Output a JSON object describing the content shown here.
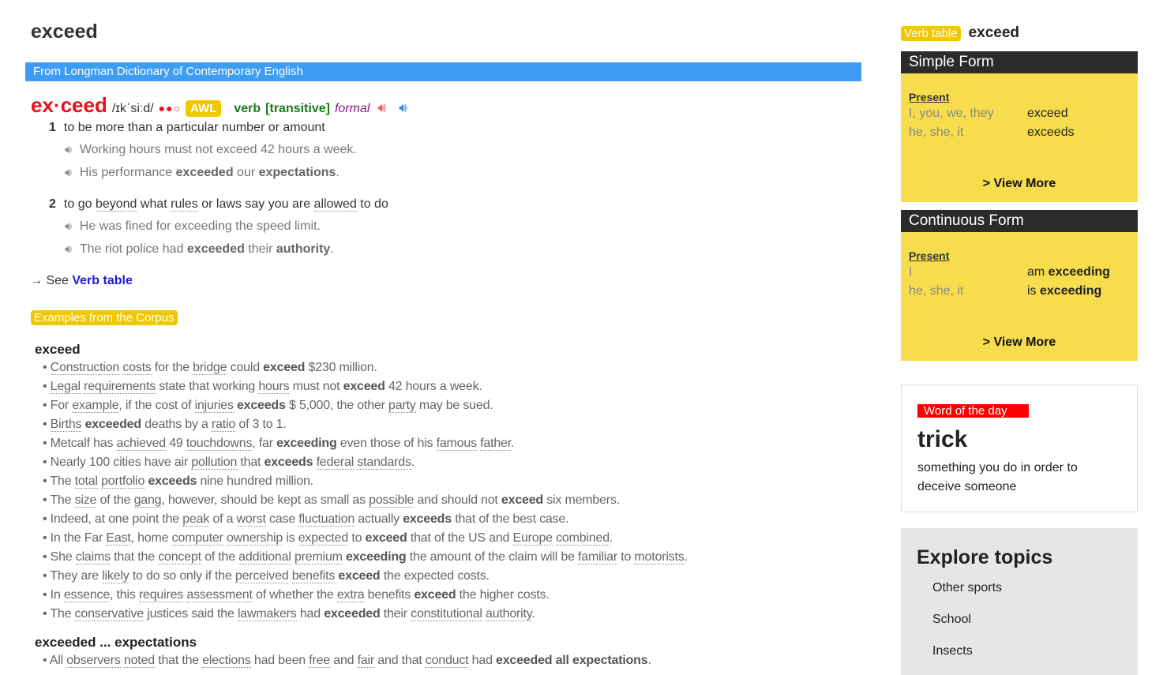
{
  "headword": "exceed",
  "source": "From Longman Dictionary of Contemporary English",
  "entry": {
    "hwd": "ex·ceed",
    "pron": "/ɪkˈsiːd/",
    "frequency_dots": "●●○",
    "awl": "AWL",
    "pos": "verb",
    "gram": "[transitive]",
    "register": "formal",
    "icons": {
      "british_audio": "speaker-red-icon",
      "american_audio": "speaker-blue-icon"
    },
    "colors": {
      "headword": "#e8101c",
      "pos": "#1d7a1d",
      "register": "#8a1a8a",
      "awl": "#f0c800"
    }
  },
  "senses": [
    {
      "num": "1",
      "def": [
        [
          "to be more than a particular number or amount",
          ""
        ]
      ],
      "examples": [
        [
          [
            "Working hours must not exceed 42 hours a week.",
            ""
          ]
        ],
        [
          [
            "His performance ",
            ""
          ],
          [
            "exceeded",
            "b"
          ],
          [
            " our ",
            ""
          ],
          [
            "expectations",
            "b"
          ],
          [
            ".",
            ""
          ]
        ]
      ]
    },
    {
      "num": "2",
      "def": [
        [
          "to go ",
          ""
        ],
        [
          "beyond",
          "u"
        ],
        [
          " what ",
          ""
        ],
        [
          "rules",
          "u"
        ],
        [
          " or laws say you are ",
          ""
        ],
        [
          "allowed",
          "u"
        ],
        [
          " to do",
          ""
        ]
      ],
      "examples": [
        [
          [
            "He was fined for exceeding the speed limit.",
            ""
          ]
        ],
        [
          [
            "The riot police had ",
            ""
          ],
          [
            "exceeded",
            "b"
          ],
          [
            " their ",
            ""
          ],
          [
            "authority",
            "b"
          ],
          [
            ".",
            ""
          ]
        ]
      ]
    }
  ],
  "see": {
    "prefix": "→ See ",
    "link": "Verb table"
  },
  "corpus": {
    "badge": "Examples from the Corpus",
    "groups": [
      {
        "title": "exceed",
        "items": [
          [
            [
              "Construction",
              "u"
            ],
            [
              " ",
              ""
            ],
            [
              "costs",
              "u"
            ],
            [
              " for the ",
              ""
            ],
            [
              "bridge",
              "u"
            ],
            [
              " could ",
              ""
            ],
            [
              "exceed",
              "b"
            ],
            [
              " $230 million.",
              ""
            ]
          ],
          [
            [
              "Legal",
              "u"
            ],
            [
              " ",
              ""
            ],
            [
              "requirements",
              "u"
            ],
            [
              " state that working ",
              ""
            ],
            [
              "hours",
              "u"
            ],
            [
              " must not ",
              ""
            ],
            [
              "exceed",
              "b"
            ],
            [
              " 42 hours a week.",
              ""
            ]
          ],
          [
            [
              "For ",
              ""
            ],
            [
              "example",
              "u"
            ],
            [
              ", if the cost of ",
              ""
            ],
            [
              "injuries",
              "u"
            ],
            [
              " ",
              ""
            ],
            [
              "exceeds",
              "b"
            ],
            [
              " $ 5,000, the other ",
              ""
            ],
            [
              "party",
              "u"
            ],
            [
              " may be sued.",
              ""
            ]
          ],
          [
            [
              "Births",
              "u"
            ],
            [
              " ",
              ""
            ],
            [
              "exceeded",
              "b"
            ],
            [
              " deaths by a ",
              ""
            ],
            [
              "ratio",
              "u"
            ],
            [
              " of 3 to 1.",
              ""
            ]
          ],
          [
            [
              "Metcalf has ",
              ""
            ],
            [
              "achieved",
              "u"
            ],
            [
              " 49 ",
              ""
            ],
            [
              "touchdowns",
              "u"
            ],
            [
              ", far ",
              ""
            ],
            [
              "exceeding",
              "b"
            ],
            [
              " even those of his ",
              ""
            ],
            [
              "famous",
              "u"
            ],
            [
              " ",
              ""
            ],
            [
              "father",
              "u"
            ],
            [
              ".",
              ""
            ]
          ],
          [
            [
              "Nearly 100 cities have air ",
              ""
            ],
            [
              "pollution",
              "u"
            ],
            [
              " that ",
              ""
            ],
            [
              "exceeds",
              "b"
            ],
            [
              " ",
              ""
            ],
            [
              "federal",
              "u"
            ],
            [
              " ",
              ""
            ],
            [
              "standards",
              "u"
            ],
            [
              ".",
              ""
            ]
          ],
          [
            [
              "The ",
              ""
            ],
            [
              "total",
              "u"
            ],
            [
              " ",
              ""
            ],
            [
              "portfolio",
              "u"
            ],
            [
              " ",
              ""
            ],
            [
              "exceeds",
              "b"
            ],
            [
              " nine hundred million.",
              ""
            ]
          ],
          [
            [
              "The ",
              ""
            ],
            [
              "size",
              "u"
            ],
            [
              " of the ",
              ""
            ],
            [
              "gang",
              "u"
            ],
            [
              ", however, should be kept as small as ",
              ""
            ],
            [
              "possible",
              "u"
            ],
            [
              " and should not ",
              ""
            ],
            [
              "exceed",
              "b"
            ],
            [
              " six members.",
              ""
            ]
          ],
          [
            [
              "Indeed, at one point the ",
              ""
            ],
            [
              "peak",
              "u"
            ],
            [
              " of a ",
              ""
            ],
            [
              "worst",
              "u"
            ],
            [
              " case ",
              ""
            ],
            [
              "fluctuation",
              "u"
            ],
            [
              " actually ",
              ""
            ],
            [
              "exceeds",
              "b"
            ],
            [
              " that of the best case.",
              ""
            ]
          ],
          [
            [
              "In the Far ",
              ""
            ],
            [
              "East",
              "u"
            ],
            [
              ", home ",
              ""
            ],
            [
              "computer",
              "u"
            ],
            [
              " ",
              ""
            ],
            [
              "ownership",
              "u"
            ],
            [
              " is ",
              ""
            ],
            [
              "expected",
              "u"
            ],
            [
              " to ",
              ""
            ],
            [
              "exceed",
              "b"
            ],
            [
              " that of the US and ",
              ""
            ],
            [
              "Europe",
              "u"
            ],
            [
              " ",
              ""
            ],
            [
              "combined",
              "u"
            ],
            [
              ".",
              ""
            ]
          ],
          [
            [
              "She ",
              ""
            ],
            [
              "claims",
              "u"
            ],
            [
              " that the ",
              ""
            ],
            [
              "concept",
              "u"
            ],
            [
              " of the ",
              ""
            ],
            [
              "additional",
              "u"
            ],
            [
              " ",
              ""
            ],
            [
              "premium",
              "u"
            ],
            [
              " ",
              ""
            ],
            [
              "exceeding",
              "b"
            ],
            [
              " the amount of the claim will be ",
              ""
            ],
            [
              "familiar",
              "u"
            ],
            [
              " to ",
              ""
            ],
            [
              "motorists",
              "u"
            ],
            [
              ".",
              ""
            ]
          ],
          [
            [
              "They are ",
              ""
            ],
            [
              "likely",
              "u"
            ],
            [
              " to do so only if the ",
              ""
            ],
            [
              "perceived",
              "u"
            ],
            [
              " ",
              ""
            ],
            [
              "benefits",
              "u"
            ],
            [
              " ",
              ""
            ],
            [
              "exceed",
              "b"
            ],
            [
              " the expected costs.",
              ""
            ]
          ],
          [
            [
              "In ",
              ""
            ],
            [
              "essence",
              "u"
            ],
            [
              ", this ",
              ""
            ],
            [
              "requires",
              "u"
            ],
            [
              " ",
              ""
            ],
            [
              "assessment",
              "u"
            ],
            [
              " of whether the ",
              ""
            ],
            [
              "extra",
              "u"
            ],
            [
              " benefits ",
              ""
            ],
            [
              "exceed",
              "b"
            ],
            [
              " the higher costs.",
              ""
            ]
          ],
          [
            [
              "The ",
              ""
            ],
            [
              "conservative",
              "u"
            ],
            [
              " justices said the ",
              ""
            ],
            [
              "lawmakers",
              "u"
            ],
            [
              " had ",
              ""
            ],
            [
              "exceeded",
              "b"
            ],
            [
              " their ",
              ""
            ],
            [
              "constitutional",
              "u"
            ],
            [
              " ",
              ""
            ],
            [
              "authority",
              "u"
            ],
            [
              ".",
              ""
            ]
          ]
        ]
      },
      {
        "title": "exceeded ... expectations",
        "items": [
          [
            [
              "All ",
              ""
            ],
            [
              "observers",
              "u"
            ],
            [
              " ",
              ""
            ],
            [
              "noted",
              "u"
            ],
            [
              " that the ",
              ""
            ],
            [
              "elections",
              "u"
            ],
            [
              " had been ",
              ""
            ],
            [
              "free",
              "u"
            ],
            [
              " and ",
              ""
            ],
            [
              "fair",
              "u"
            ],
            [
              " and that ",
              ""
            ],
            [
              "conduct",
              "u"
            ],
            [
              " had ",
              ""
            ],
            [
              "exceeded all expectations",
              "b"
            ],
            [
              ".",
              ""
            ]
          ]
        ]
      }
    ]
  },
  "verb_table": {
    "badge": "Verb table",
    "word": "exceed",
    "cards": [
      {
        "title": "Simple Form",
        "tense": "Present",
        "view_more": "> View More",
        "rows": [
          {
            "pronoun": "I, you, we, they",
            "aux": "",
            "form": "exceed",
            "bold": false
          },
          {
            "pronoun": "he, she, it",
            "aux": "",
            "form": "exceeds",
            "bold": false
          }
        ]
      },
      {
        "title": "Continuous Form",
        "tense": "Present",
        "view_more": "> View More",
        "rows": [
          {
            "pronoun": "I",
            "aux": "am ",
            "form": "exceeding",
            "bold": true
          },
          {
            "pronoun": "he, she, it",
            "aux": "is ",
            "form": "exceeding",
            "bold": true
          }
        ]
      }
    ]
  },
  "word_of_day": {
    "badge": "Word of the day",
    "word": "trick",
    "definition": "something you do in order to deceive someone"
  },
  "explore": {
    "title": "Explore topics",
    "topics": [
      "Other sports",
      "School",
      "Insects"
    ]
  }
}
